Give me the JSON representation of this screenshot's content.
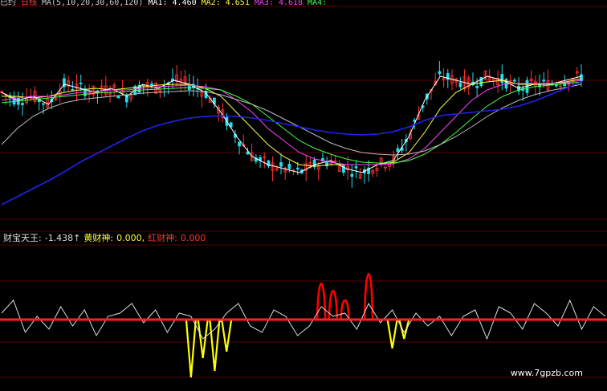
{
  "main_header": [
    {
      "text": "已约",
      "color": "#cccccc"
    },
    {
      "text": "日线",
      "color": "#ff4444"
    },
    {
      "text": "MA(5,10,20,30,60,120)",
      "color": "#cccccc"
    },
    {
      "text": "MA1:",
      "color": "#ffffff"
    },
    {
      "text": "4.460",
      "color": "#ffffff"
    },
    {
      "text": "MA2:",
      "color": "#ffff44"
    },
    {
      "text": "4.651",
      "color": "#ffff44"
    },
    {
      "text": "MA3:",
      "color": "#ff44ff"
    },
    {
      "text": "4.618",
      "color": "#ff44ff"
    },
    {
      "text": "MA4:",
      "color": "#44ff44"
    }
  ],
  "sub_header": [
    {
      "text": "财宝天王:",
      "color": "#dddddd"
    },
    {
      "text": "-1.438↑",
      "color": "#dddddd"
    },
    {
      "text": "黄财神:",
      "color": "#ffff33"
    },
    {
      "text": "0.000,",
      "color": "#ffff33"
    },
    {
      "text": "红财神:",
      "color": "#ff3333"
    },
    {
      "text": "0.000",
      "color": "#ff3333"
    }
  ],
  "watermark": "www.7gpzb.com",
  "colors": {
    "up": "#ff3333",
    "down": "#22ddee",
    "ma1": "#ffffff",
    "ma2": "#ffff44",
    "ma3": "#ff44ff",
    "ma4": "#44ff44",
    "ma5": "#bbbbbb",
    "ma6": "#2222ee",
    "zero": "#ff2222",
    "grid": "#5a0000",
    "main_line": "#dddddd",
    "yellow_fill": "#ffff00",
    "red_fill": "#ff0000"
  },
  "chart_data": [
    {
      "type": "line",
      "name": "price_ma_panel",
      "series": [
        {
          "name": "MA1",
          "values": [
            4.85,
            4.75,
            4.8,
            4.7,
            4.95,
            4.9,
            4.85,
            4.9,
            4.8,
            4.95,
            4.9,
            5.0,
            4.95,
            4.85,
            4.6,
            4.3,
            4.05,
            3.95,
            3.9,
            3.85,
            3.95,
            4.0,
            3.9,
            3.85,
            3.95,
            4.0,
            4.3,
            4.75,
            5.05,
            5.0,
            4.95,
            5.05,
            5.0,
            4.9,
            4.95,
            4.95,
            5.0,
            5.05
          ]
        },
        {
          "name": "MA2",
          "values": [
            4.8,
            4.8,
            4.78,
            4.8,
            4.85,
            4.88,
            4.9,
            4.88,
            4.9,
            4.92,
            4.94,
            4.95,
            4.95,
            4.9,
            4.8,
            4.6,
            4.4,
            4.2,
            4.05,
            3.95,
            3.93,
            3.95,
            3.95,
            3.95,
            3.95,
            3.98,
            4.1,
            4.35,
            4.65,
            4.85,
            4.95,
            4.98,
            5.0,
            4.95,
            4.95,
            4.96,
            4.98,
            5.02
          ]
        },
        {
          "name": "MA3",
          "values": [
            4.75,
            4.78,
            4.8,
            4.8,
            4.82,
            4.85,
            4.86,
            4.88,
            4.88,
            4.9,
            4.92,
            4.93,
            4.94,
            4.92,
            4.88,
            4.75,
            4.6,
            4.4,
            4.25,
            4.1,
            4.02,
            3.98,
            3.95,
            3.95,
            3.95,
            3.96,
            4.02,
            4.15,
            4.35,
            4.55,
            4.75,
            4.88,
            4.95,
            4.96,
            4.96,
            4.96,
            4.97,
            5.0
          ]
        },
        {
          "name": "MA4",
          "values": [
            4.72,
            4.74,
            4.76,
            4.78,
            4.8,
            4.82,
            4.84,
            4.85,
            4.86,
            4.88,
            4.89,
            4.9,
            4.91,
            4.9,
            4.88,
            4.8,
            4.7,
            4.55,
            4.4,
            4.25,
            4.15,
            4.08,
            4.02,
            3.98,
            3.97,
            3.97,
            4.0,
            4.08,
            4.2,
            4.35,
            4.52,
            4.68,
            4.8,
            4.88,
            4.92,
            4.94,
            4.96,
            4.98
          ]
        },
        {
          "name": "MA5",
          "values": [
            4.2,
            4.4,
            4.55,
            4.65,
            4.72,
            4.76,
            4.78,
            4.8,
            4.82,
            4.84,
            4.85,
            4.86,
            4.87,
            4.86,
            4.82,
            4.76,
            4.7,
            4.62,
            4.52,
            4.42,
            4.32,
            4.22,
            4.15,
            4.1,
            4.08,
            4.07,
            4.08,
            4.12,
            4.2,
            4.3,
            4.42,
            4.55,
            4.66,
            4.75,
            4.82,
            4.87,
            4.91,
            4.95
          ]
        },
        {
          "name": "MA6",
          "values": [
            3.45,
            3.55,
            3.65,
            3.75,
            3.86,
            3.98,
            4.08,
            4.18,
            4.28,
            4.37,
            4.44,
            4.49,
            4.53,
            4.55,
            4.56,
            4.55,
            4.53,
            4.5,
            4.46,
            4.42,
            4.38,
            4.35,
            4.33,
            4.32,
            4.33,
            4.36,
            4.42,
            4.5,
            4.56,
            4.58,
            4.6,
            4.62,
            4.64,
            4.68,
            4.74,
            4.82,
            4.9,
            4.98
          ]
        }
      ]
    },
    {
      "type": "line",
      "name": "oscillator_panel",
      "series": [
        {
          "name": "财宝天王",
          "values": [
            0.2,
            0.6,
            -0.4,
            0.1,
            -0.3,
            0.4,
            -0.2,
            0.3,
            -0.5,
            0.1,
            0.2,
            0.5,
            -0.1,
            0.3,
            -0.4,
            0.2,
            0.1,
            -0.6,
            -0.3,
            0.2,
            0.5,
            -0.2,
            -0.4,
            0.3,
            0.1,
            -0.5,
            -0.2,
            0.4,
            0.1,
            0.2,
            -0.3,
            0.5,
            -0.1,
            0.3,
            -0.4,
            0.2,
            -0.2,
            0.1,
            -0.5,
            0.1,
            0.3,
            -0.6,
            0.4,
            0.2,
            -0.3,
            0.5,
            0.2,
            -0.2,
            0.6,
            -0.3,
            0.4,
            0.1
          ]
        },
        {
          "name": "黄财神",
          "values": [
            0,
            0,
            0,
            0,
            0,
            0,
            0,
            0,
            0,
            0,
            0,
            0,
            0,
            0,
            0,
            0,
            -1.8,
            -1.2,
            -1.6,
            -1.0,
            0,
            0,
            0,
            0,
            0,
            0,
            0,
            0,
            0,
            0,
            0,
            0,
            0,
            -0.9,
            -0.6,
            0,
            0,
            0,
            0,
            0,
            0,
            0,
            0,
            0,
            0,
            0,
            0,
            0,
            0,
            0,
            0,
            0
          ]
        },
        {
          "name": "红财神",
          "values": [
            0,
            0,
            0,
            0,
            0,
            0,
            0,
            0,
            0,
            0,
            0,
            0,
            0,
            0,
            0,
            0,
            0,
            0,
            0,
            0,
            0,
            0,
            0,
            0,
            0,
            0,
            0,
            1.5,
            1.2,
            0.8,
            0,
            1.9,
            0,
            0,
            0,
            0,
            0,
            0,
            0,
            0,
            0,
            0,
            0,
            0,
            0,
            0,
            0,
            0,
            0,
            0,
            0,
            0
          ]
        }
      ]
    }
  ]
}
